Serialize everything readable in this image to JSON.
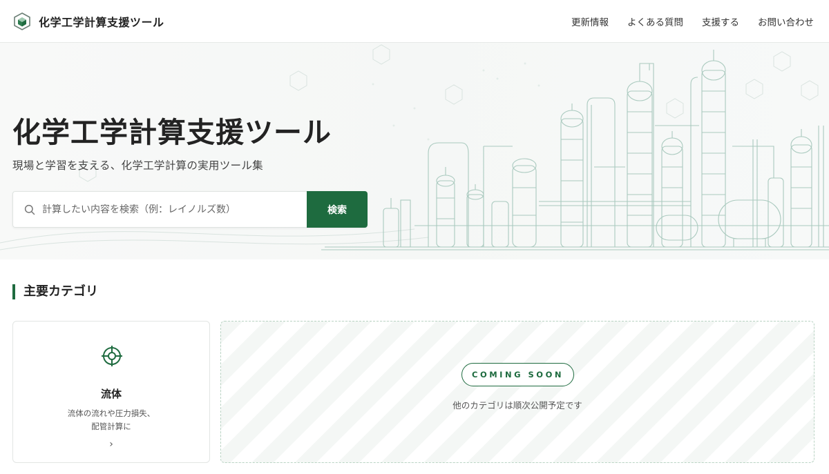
{
  "header": {
    "brand_name": "化学工学計算支援ツール",
    "nav": [
      "更新情報",
      "よくある質問",
      "支援する",
      "お問い合わせ"
    ]
  },
  "hero": {
    "title": "化学工学計算支援ツール",
    "subtitle": "現場と学習を支える、化学工学計算の実用ツール集",
    "search": {
      "placeholder": "計算したい内容を検索（例：レイノルズ数）",
      "value": "",
      "button_label": "検索"
    }
  },
  "categories": {
    "title": "主要カテゴリ",
    "cards": [
      {
        "title": "流体",
        "description_lines": [
          "流体の流れや圧力損失、",
          "配管計算に"
        ],
        "arrow": "›",
        "icon": "target-icon"
      }
    ],
    "coming_soon": {
      "badge": "COMING SOON",
      "text": "他のカテゴリは順次公開予定です"
    }
  },
  "colors": {
    "accent": "#1e6b3f",
    "background": "#ffffff",
    "hero_bg": "#f6f8f7",
    "line_art": "#9fc4b8"
  }
}
